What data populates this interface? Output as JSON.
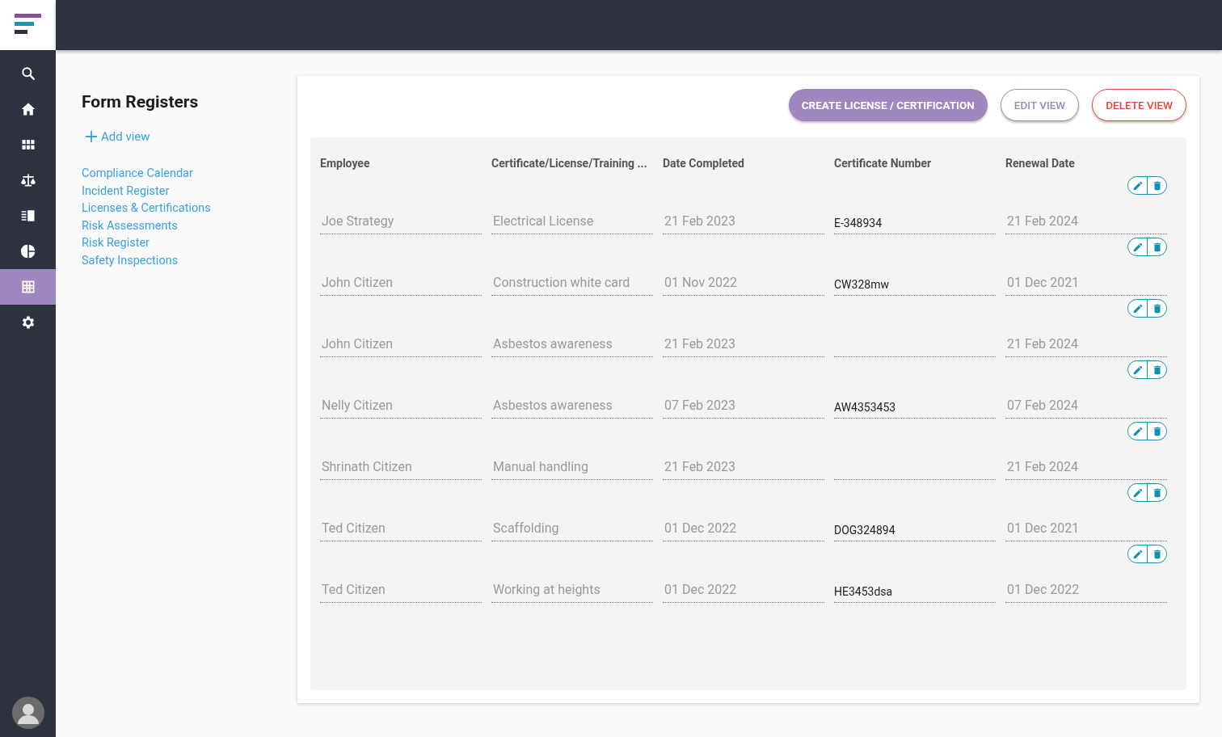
{
  "nav": [
    {
      "kind": "search",
      "selected": false
    },
    {
      "kind": "home",
      "selected": false
    },
    {
      "kind": "apps",
      "selected": false
    },
    {
      "kind": "scale",
      "selected": false
    },
    {
      "kind": "list",
      "selected": false
    },
    {
      "kind": "pie",
      "selected": false
    },
    {
      "kind": "grid",
      "selected": true
    },
    {
      "kind": "settings",
      "selected": false
    }
  ],
  "registers": {
    "title": "Form Registers",
    "add_view": "Add view",
    "items": [
      "Compliance Calendar",
      "Incident Register",
      "Licenses & Certifications",
      "Risk Assessments",
      "Risk Register",
      "Safety Inspections"
    ]
  },
  "actions": {
    "create": "CREATE LICENSE / CERTIFICATION",
    "edit": "EDIT VIEW",
    "delete": "DELETE VIEW"
  },
  "table": {
    "columns": [
      "Employee",
      "Certificate/License/Training ...",
      "Date Completed",
      "Certificate Number",
      "Renewal Date"
    ],
    "rows": [
      {
        "employee": "Joe Strategy",
        "certificate": "Electrical License",
        "date_completed": "21 Feb 2023",
        "certificate_number": "E-348934",
        "renewal_date": "21 Feb 2024"
      },
      {
        "employee": "John Citizen",
        "certificate": "Construction white card",
        "date_completed": "01 Nov 2022",
        "certificate_number": "CW328mw",
        "renewal_date": "01 Dec 2021"
      },
      {
        "employee": "John Citizen",
        "certificate": "Asbestos awareness",
        "date_completed": "21 Feb 2023",
        "renewal_date": "21 Feb 2024"
      },
      {
        "employee": "Nelly Citizen",
        "certificate": "Asbestos awareness",
        "date_completed": "07 Feb 2023",
        "certificate_number": "AW4353453",
        "renewal_date": "07 Feb 2024"
      },
      {
        "employee": "Shrinath Citizen",
        "certificate": "Manual handling",
        "date_completed": "21 Feb 2023",
        "renewal_date": "21 Feb 2024"
      },
      {
        "employee": "Ted Citizen",
        "certificate": "Scaffolding",
        "date_completed": "01 Dec 2022",
        "certificate_number": "DOG324894",
        "renewal_date": "01 Dec 2021"
      },
      {
        "employee": "Ted Citizen",
        "certificate": "Working at heights",
        "date_completed": "01 Dec 2022",
        "certificate_number": "HE3453dsa",
        "renewal_date": "01 Dec 2022"
      }
    ]
  }
}
